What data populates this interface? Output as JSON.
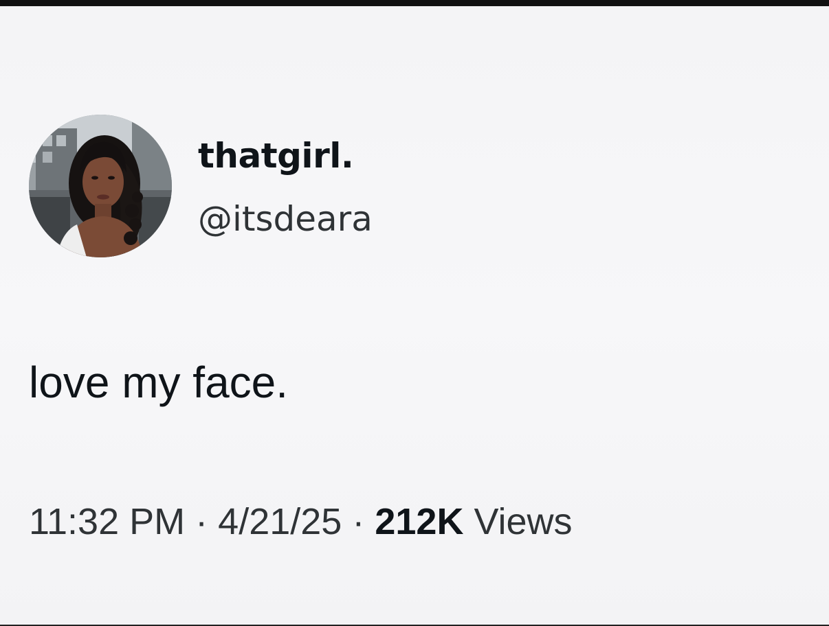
{
  "tweet": {
    "display_name": "thatgirl.",
    "handle": "@itsdeara",
    "text": "love my face.",
    "time": "11:32 PM",
    "separator": "·",
    "date": "4/21/25",
    "views_count": "212K",
    "views_label": "Views"
  },
  "colors": {
    "background": "#f5f5f7",
    "text_primary": "#0f1419",
    "text_secondary": "#2f3336"
  },
  "icons": {
    "avatar": "profile-photo"
  }
}
